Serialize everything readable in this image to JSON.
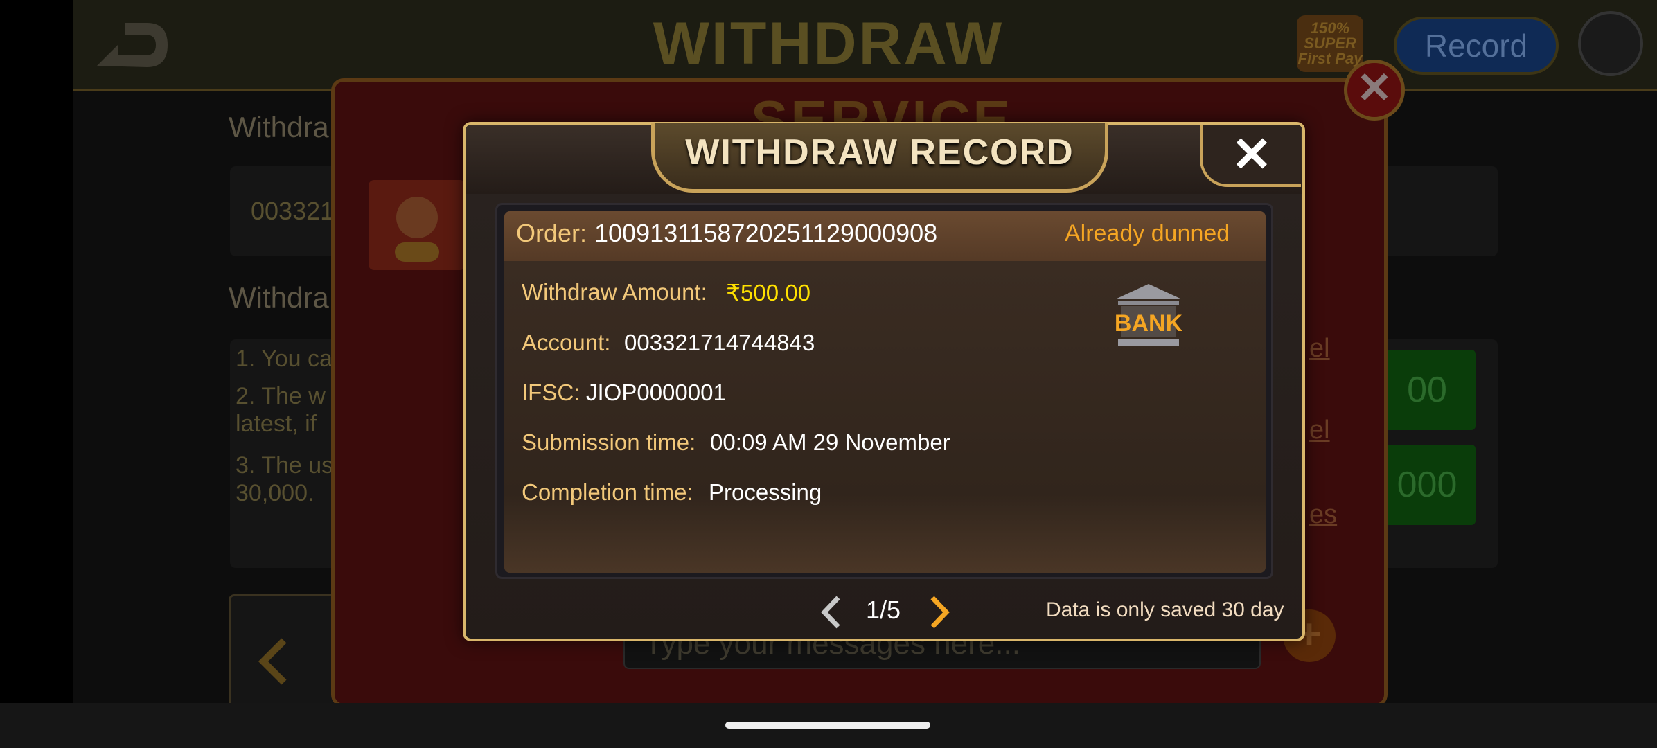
{
  "header": {
    "title": "WITHDRAW",
    "promo_badge": "150% SUPER First Pay",
    "record_label": "Record"
  },
  "background": {
    "withdraw_label_1": "Withdra",
    "account_partial": "003321",
    "withdraw_label_2": "Withdra",
    "rule_1": "1. You ca",
    "rule_2a": "2. The w",
    "rule_2b": "latest, if",
    "rule_3a": "3. The us",
    "rule_3b": "30,000.",
    "amount_btn_1": "00",
    "amount_btn_2": "000",
    "side_link_1": "el",
    "side_link_2": "el",
    "side_link_3": "es"
  },
  "service": {
    "title": "SERVICE",
    "message_placeholder": "Type your messages here..."
  },
  "dialog": {
    "title": "WITHDRAW RECORD",
    "order_label": "Order:",
    "order_value": "1009131158720251129000908",
    "status": "Already dunned",
    "amount_label": "Withdraw Amount:",
    "amount_value": "₹500.00",
    "account_label": "Account:",
    "account_value": "003321714744843",
    "ifsc_label": "IFSC:",
    "ifsc_value": "JIOP0000001",
    "submission_label": "Submission time:",
    "submission_value": "00:09 AM 29 November",
    "completion_label": "Completion time:",
    "completion_value": "Processing",
    "bank_text": "BANK",
    "page": "1/5",
    "note": "Data is only saved 30 day"
  },
  "colors": {
    "gold_label": "#f2c87a",
    "status_orange": "#f5a623",
    "amount_yellow": "#ffe100",
    "dialog_border": "#d9b66b"
  },
  "icons": [
    "back-arrow-icon",
    "close-icon",
    "bank-icon",
    "chevron-left-icon",
    "chevron-right-icon",
    "plus-icon",
    "support-agent-icon"
  ]
}
